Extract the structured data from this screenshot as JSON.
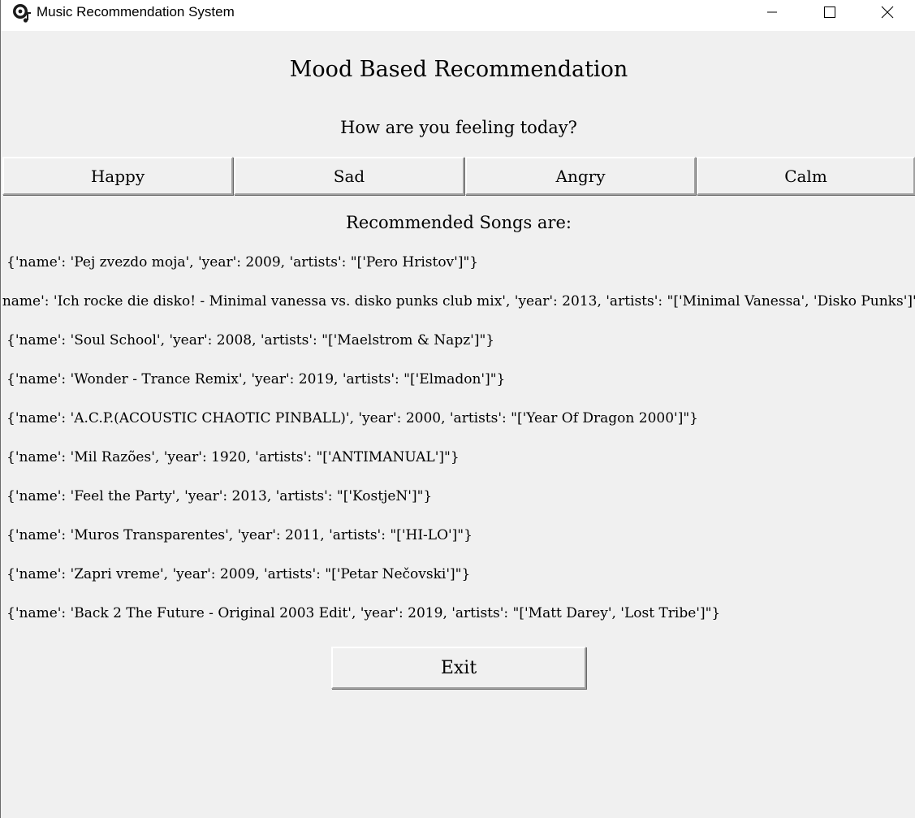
{
  "window": {
    "title": "Music Recommendation System",
    "app_icon": "music-disc-icon",
    "controls": {
      "minimize_icon": "minimize-icon",
      "maximize_icon": "maximize-icon",
      "close_icon": "close-icon"
    }
  },
  "page": {
    "heading": "Mood Based Recommendation",
    "prompt": "How are you feeling today?",
    "moods": [
      {
        "label": "Happy"
      },
      {
        "label": "Sad"
      },
      {
        "label": "Angry"
      },
      {
        "label": "Calm"
      }
    ],
    "recommended_heading": "Recommended Songs are:",
    "songs": [
      "{'name': 'Pej zvezdo moja', 'year': 2009, 'artists': \"['Pero Hristov']\"}",
      "{'name': 'Ich rocke die disko! - Minimal vanessa vs. disko punks club mix', 'year': 2013, 'artists': \"['Minimal Vanessa', 'Disko Punks']\"}",
      "{'name': 'Soul School', 'year': 2008, 'artists': \"['Maelstrom & Napz']\"}",
      "{'name': 'Wonder - Trance Remix', 'year': 2019, 'artists': \"['Elmadon']\"}",
      "{'name': 'A.C.P.(ACOUSTIC CHAOTIC PINBALL)', 'year': 2000, 'artists': \"['Year Of Dragon 2000']\"}",
      "{'name': 'Mil Razões', 'year': 1920, 'artists': \"['ANTIMANUAL']\"}",
      "{'name': 'Feel the Party', 'year': 2013, 'artists': \"['KostjeN']\"}",
      "{'name': 'Muros Transparentes', 'year': 2011, 'artists': \"['HI-LO']\"}",
      "{'name': 'Zapri vreme', 'year': 2009, 'artists': \"['Petar Nečovski']\"}",
      "{'name': 'Back 2 The Future - Original 2003 Edit', 'year': 2019, 'artists': \"['Matt Darey', 'Lost Tribe']\"}"
    ],
    "exit_label": "Exit"
  },
  "colors": {
    "window_background": "#f0f0f0",
    "titlebar_background": "#ffffff",
    "text": "#000000"
  }
}
